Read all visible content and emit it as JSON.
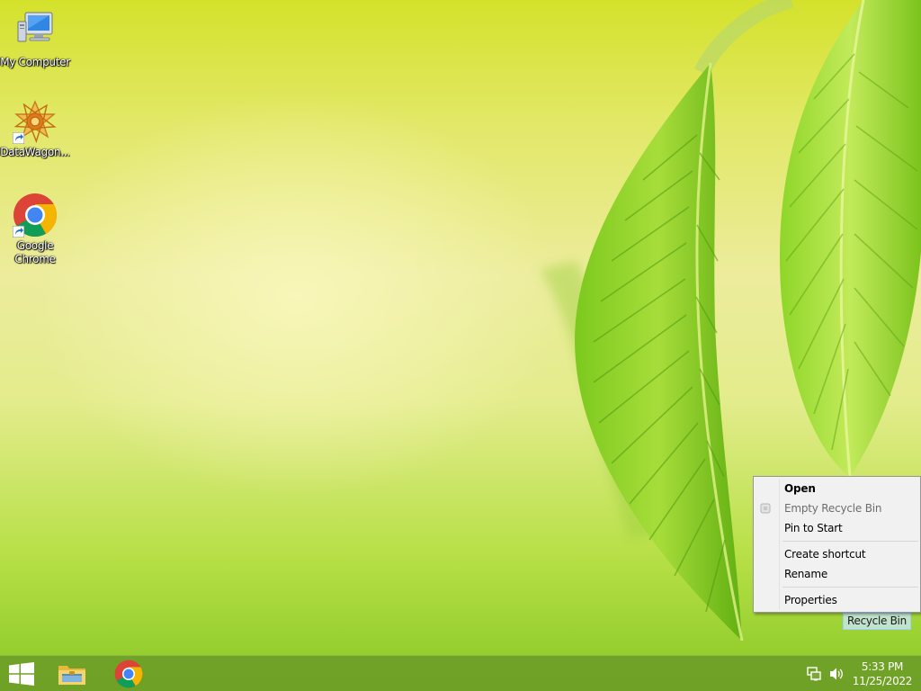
{
  "desktop": {
    "icons": [
      {
        "id": "my-computer",
        "label": "My Computer"
      },
      {
        "id": "datawagon",
        "label": "DataWagon..."
      },
      {
        "id": "google-chrome",
        "label": "Google Chrome"
      }
    ],
    "recycle_bin": {
      "label": "Recycle Bin"
    }
  },
  "context_menu": {
    "items": [
      {
        "label": "Open",
        "bold": true,
        "enabled": true
      },
      {
        "label": "Empty Recycle Bin",
        "bold": false,
        "enabled": false,
        "icon": "empty-recycle-bin-icon"
      },
      {
        "label": "Pin to Start",
        "bold": false,
        "enabled": true
      },
      {
        "label": "Create shortcut",
        "bold": false,
        "enabled": true
      },
      {
        "label": "Rename",
        "bold": false,
        "enabled": true
      },
      {
        "label": "Properties",
        "bold": false,
        "enabled": true
      }
    ]
  },
  "taskbar": {
    "pinned": [
      {
        "id": "start",
        "icon": "windows-logo-icon"
      },
      {
        "id": "file-explorer",
        "icon": "file-explorer-icon"
      },
      {
        "id": "chrome",
        "icon": "chrome-icon"
      }
    ],
    "tray": {
      "icons": [
        "network-icon",
        "volume-icon"
      ],
      "time": "5:33 PM",
      "date": "11/25/2022"
    }
  },
  "colors": {
    "taskbar": "#6a9628",
    "menu_background": "#f1f1f1",
    "selection": "#cce8ff"
  }
}
